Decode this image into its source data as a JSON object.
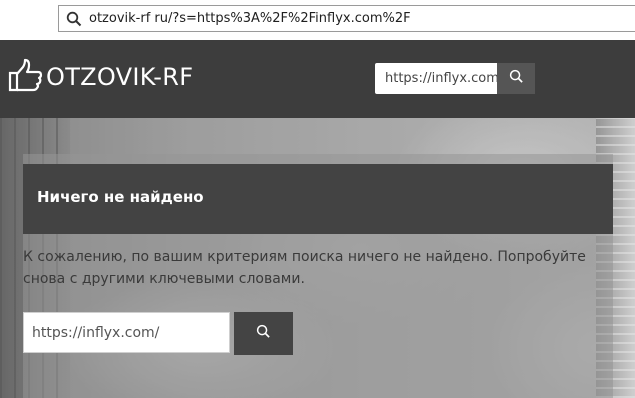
{
  "browser": {
    "address": "otzovik-rf ru/?s=https%3A%2F%2Finflyx.com%2F",
    "address_icon": "search-icon"
  },
  "header": {
    "logo_text": "OTZOVIK-RF",
    "logo_icon": "thumbs-up-icon",
    "search_value": "https://inflyx.com/",
    "search_icon": "search-icon",
    "background_color": "#3d3d3d"
  },
  "main": {
    "title": "Ничего не найдено",
    "message": "К сожалению, по вашим критериям поиска ничего не найдено. Попробуйте снова с другими ключевыми словами.",
    "search_value": "https://inflyx.com/",
    "search_icon": "search-icon"
  }
}
